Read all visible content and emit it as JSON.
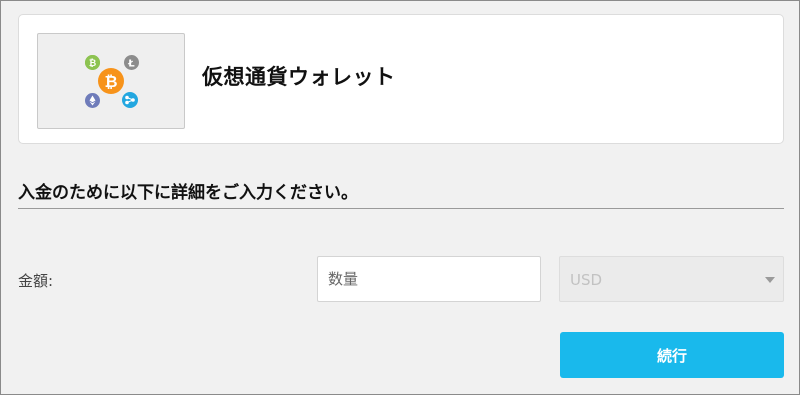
{
  "wallet": {
    "title": "仮想通貨ウォレット",
    "logo_icons": [
      "bitcoin-cash-icon",
      "litecoin-icon",
      "bitcoin-icon",
      "ethereum-icon",
      "ripple-icon"
    ]
  },
  "form": {
    "instruction": "入金のために以下に詳細をご入力ください。",
    "amount_label": "金額:",
    "amount_placeholder": "数量",
    "currency_value": "USD",
    "continue_label": "続行"
  },
  "colors": {
    "button": "#19b9ec",
    "bitcoin": "#f7931a",
    "bitcoin_cash": "#8dc351",
    "litecoin": "#8c8c8c",
    "ethereum": "#6f7cba",
    "ripple": "#23a7e0"
  }
}
